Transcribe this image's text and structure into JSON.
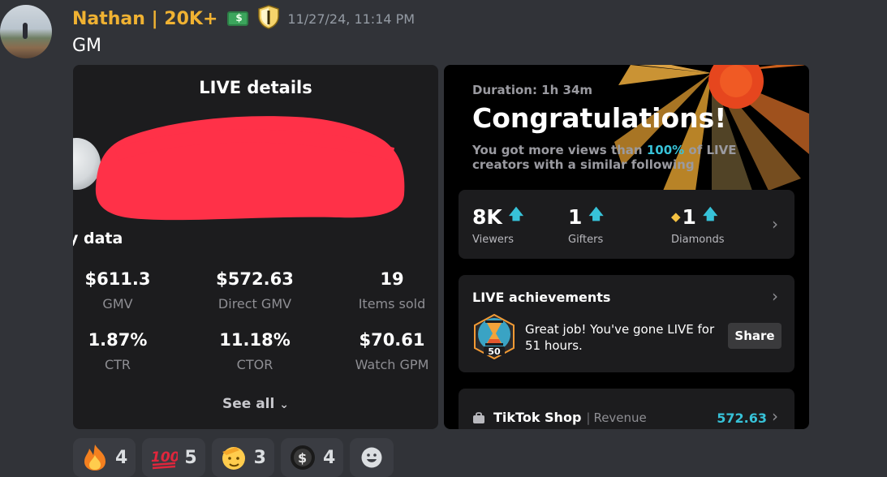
{
  "message": {
    "username": "Nathan | 20K+",
    "timestamp": "11/27/24, 11:14 PM",
    "text": "GM"
  },
  "live_details": {
    "title": "LIVE details",
    "section_title": "y data",
    "stats": [
      {
        "value": "$611.3",
        "label": "GMV"
      },
      {
        "value": "$572.63",
        "label": "Direct GMV"
      },
      {
        "value": "19",
        "label": "Items sold"
      },
      {
        "value": "1.87%",
        "label": "CTR"
      },
      {
        "value": "11.18%",
        "label": "CTOR"
      },
      {
        "value": "$70.61",
        "label": "Watch GPM"
      }
    ],
    "see_all": "See all"
  },
  "summary": {
    "duration": "Duration: 1h 34m",
    "headline": "Congratulations!",
    "views_prefix": "You got more views than ",
    "views_pct": "100%",
    "views_suffix": " of LIVE creators with a similar following",
    "metrics": [
      {
        "value": "8K",
        "label": "Viewers"
      },
      {
        "value": "1",
        "label": "Gifters"
      },
      {
        "value": "1",
        "label": "Diamonds"
      }
    ],
    "achievements_title": "LIVE achievements",
    "achievement_text": "Great job! You've gone LIVE for 51 hours.",
    "medal_number": "50",
    "share_label": "Share",
    "shop_name": "TikTok Shop",
    "shop_separator": "|",
    "shop_revenue_label": "Revenue",
    "shop_value": "572.63"
  },
  "reactions": [
    {
      "emoji": "fire-emoji",
      "count": "4"
    },
    {
      "emoji": "hundred-emoji",
      "count": "5"
    },
    {
      "emoji": "salute-emoji",
      "count": "3"
    },
    {
      "emoji": "coin-emoji",
      "count": "4"
    }
  ],
  "colors": {
    "username": "#f0b232",
    "accent_cyan": "#37c2d8",
    "redaction": "#ff3148"
  }
}
